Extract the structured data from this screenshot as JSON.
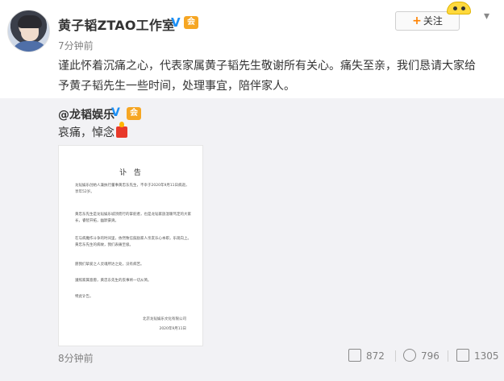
{
  "header": {
    "user_name": "黄子韬ZTAO工作室",
    "verified_glyph": "V",
    "vip_glyph": "会",
    "time": "7分钟前",
    "follow_label": "关注",
    "follow_plus": "+",
    "dropdown_glyph": "▾"
  },
  "post": {
    "text": "谨此怀着沉痛之心，代表家属黄子韬先生敬谢所有关心。痛失至亲，我们恳请大家给予黄子韬先生一些时间，处理事宜，陪伴家人。"
  },
  "repost": {
    "user_name": "@龙韬娱乐",
    "verified_glyph": "V",
    "vip_glyph": "会",
    "text": "哀痛，悼念",
    "time": "8分钟前"
  },
  "notice": {
    "title": "讣 告",
    "paragraphs": [
      "龙韬娱乐创始人兼执行董事黄忠东先生，不幸于2020年9月11日病逝，享年52岁。",
      "黄忠东先生是龙韬娱乐城顶而行的掌舵者，也是龙韬家族温暖笃定的大家长，睿智开拓，幽默豪爽。",
      "在与病魔作斗争的时间里，依然致信鼓励家人亲友乐心本职，乐观向上。黄忠东先生的病故，我们表痛至极。",
      "愿我们挚爱之人灵魂所达之处，没有病苦。",
      "遵照家属意愿，黄忠东先生的丧事将一切从简。",
      "特此讣告。"
    ],
    "signature_org": "北京龙韬娱乐文化有限公司",
    "signature_date": "2020年9月11日"
  },
  "actions": {
    "repost_count": "872",
    "comment_count": "796",
    "like_count": "1305"
  },
  "colors": {
    "accent_orange": "#ff8200",
    "verified_blue": "#1c8ff5",
    "repost_bg": "#f2f2f5"
  }
}
